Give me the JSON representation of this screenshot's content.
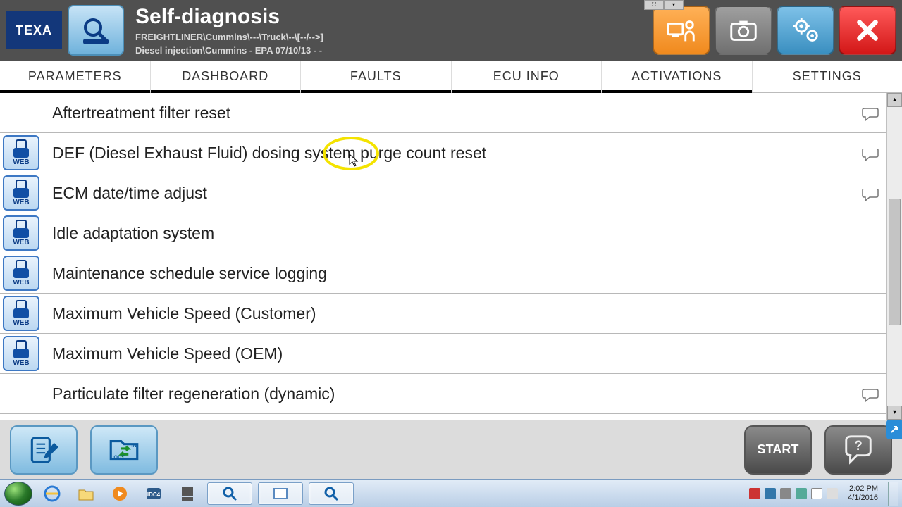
{
  "header": {
    "logo": "TEXA",
    "title": "Self-diagnosis",
    "path_line1": "FREIGHTLINER\\Cummins\\---\\Truck\\--\\[--/-->]",
    "path_line2": "Diesel injection\\Cummins - EPA 07/10/13 - -"
  },
  "tabs": [
    {
      "label": "PARAMETERS"
    },
    {
      "label": "DASHBOARD"
    },
    {
      "label": "FAULTS"
    },
    {
      "label": "ECU INFO"
    },
    {
      "label": "ACTIVATIONS"
    },
    {
      "label": "SETTINGS",
      "active": true
    }
  ],
  "settings_items": [
    {
      "label": "Aftertreatment filter reset",
      "locked": false,
      "hint": true
    },
    {
      "label": "DEF (Diesel Exhaust Fluid) dosing system purge count reset",
      "locked": true,
      "hint": true
    },
    {
      "label": "ECM date/time adjust",
      "locked": true,
      "hint": true
    },
    {
      "label": "Idle adaptation system",
      "locked": true,
      "hint": false
    },
    {
      "label": "Maintenance schedule service logging",
      "locked": true,
      "hint": false
    },
    {
      "label": "Maximum Vehicle Speed (Customer)",
      "locked": true,
      "hint": false
    },
    {
      "label": "Maximum Vehicle Speed (OEM)",
      "locked": true,
      "hint": false
    },
    {
      "label": "Particulate filter regeneration (dynamic)",
      "locked": false,
      "hint": true
    }
  ],
  "footer": {
    "start_label": "START"
  },
  "web_icon_text": "WEB",
  "taskbar": {
    "time": "2:02 PM",
    "date": "4/1/2016"
  }
}
